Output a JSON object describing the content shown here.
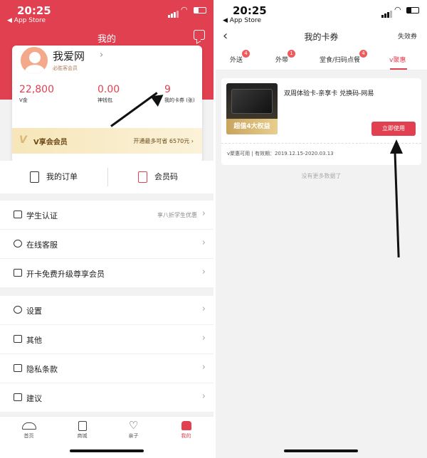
{
  "status": {
    "time": "20:25",
    "back_app": "◀ App Store"
  },
  "left": {
    "header_title": "我的",
    "user": {
      "name": "我爱网",
      "badge": "必胜客会员"
    },
    "stats": [
      {
        "value": "22,800",
        "label": "V金"
      },
      {
        "value": "0.00",
        "label": "神钱包"
      },
      {
        "value": "9",
        "label": "我的卡券 (张)"
      }
    ],
    "vip": {
      "logo": "V",
      "name": "V享会会员",
      "save": "开通最多可省 6570元 ›"
    },
    "orders": [
      {
        "label": "我的订单",
        "icon": "order-icon"
      },
      {
        "label": "会员码",
        "icon": "member-code-icon"
      }
    ],
    "menu_group1": [
      {
        "label": "学生认证",
        "right": "享八折学生优惠",
        "icon": "graduation-cap-icon"
      },
      {
        "label": "在线客服",
        "right": "",
        "icon": "customer-service-icon"
      },
      {
        "label": "开卡免费升级尊享会员",
        "right": "",
        "icon": "camera-card-icon"
      }
    ],
    "menu_group2": [
      {
        "label": "设置",
        "right": "",
        "icon": "settings-icon"
      },
      {
        "label": "其他",
        "right": "",
        "icon": "other-icon"
      },
      {
        "label": "隐私条款",
        "right": "",
        "icon": "privacy-icon"
      },
      {
        "label": "建议",
        "right": "",
        "icon": "suggest-icon"
      }
    ],
    "tabbar": [
      {
        "label": "首页",
        "active": false
      },
      {
        "label": "商城",
        "active": false
      },
      {
        "label": "亲子",
        "active": false
      },
      {
        "label": "我的",
        "active": true
      }
    ]
  },
  "right": {
    "title": "我的卡券",
    "expired": "失效券",
    "tabs": [
      {
        "label": "外送",
        "badge": "4"
      },
      {
        "label": "外带",
        "badge": "1"
      },
      {
        "label": "堂食/扫码点餐",
        "badge": "4"
      },
      {
        "label": "v聚惠",
        "badge": ""
      }
    ],
    "coupon": {
      "title": "双周体验卡-亲享卡 兑换码-网易",
      "thumb_text": "超值4大权益",
      "button": "立即使用",
      "footer": "v聚惠可用   |   有效期：2019.12.15-2020.03.13"
    },
    "no_more": "没有更多数据了"
  },
  "colors": {
    "brand_red": "#e14050",
    "gold": "#d9b774"
  }
}
